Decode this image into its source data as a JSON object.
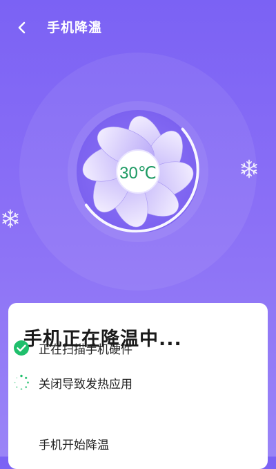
{
  "header": {
    "title": "手机降温",
    "back_icon": "chevron-left-icon"
  },
  "status": {
    "temperature": "30℃"
  },
  "card": {
    "title": "手机正在降温中...",
    "steps": [
      {
        "label": "正在扫描手机硬件",
        "state": "done",
        "icon": "check-circle-icon"
      },
      {
        "label": "关闭导致发热应用",
        "state": "in-progress",
        "icon": "spinner-icon"
      },
      {
        "label": "手机开始降温",
        "state": "pending",
        "icon": ""
      }
    ]
  },
  "colors": {
    "background_top": "#7b62f4",
    "background_bottom": "#9a84f7",
    "accent_green": "#1fbf6c",
    "temperature_text": "#1d9a63",
    "card_bg": "#ffffff"
  }
}
